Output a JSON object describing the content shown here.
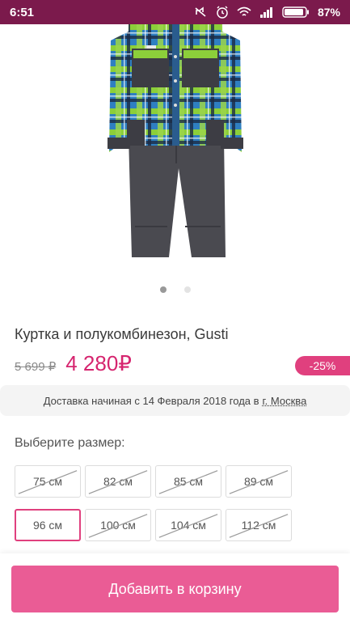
{
  "status_bar": {
    "time": "6:51",
    "battery": "87%",
    "icons": [
      "mute-icon",
      "alarm-icon",
      "wifi-icon",
      "signal-icon",
      "battery-icon"
    ]
  },
  "product": {
    "image_icon": "snowsuit-image",
    "carousel": {
      "count": 2,
      "active": 1
    },
    "title": "Куртка и полукомбинезон, Gusti",
    "old_price": "5 699 ₽",
    "price": "4 280₽",
    "discount": "-25%"
  },
  "delivery": {
    "text": "Доставка начиная с 14 Февраля 2018 года в",
    "city": "г. Москва"
  },
  "sizes": {
    "label": "Выберите размер:",
    "options": [
      {
        "label": "75 см",
        "available": false,
        "selected": false
      },
      {
        "label": "82 см",
        "available": false,
        "selected": false
      },
      {
        "label": "85 см",
        "available": false,
        "selected": false
      },
      {
        "label": "89 см",
        "available": false,
        "selected": false
      },
      {
        "label": "96 см",
        "available": true,
        "selected": true
      },
      {
        "label": "100 см",
        "available": false,
        "selected": false
      },
      {
        "label": "104 см",
        "available": false,
        "selected": false
      },
      {
        "label": "112 см",
        "available": false,
        "selected": false
      }
    ]
  },
  "actions": {
    "add_to_cart": "Добавить в корзину"
  },
  "colors": {
    "status_bar": "#7b1a4c",
    "accent": "#d6256f",
    "button": "#ea5c95"
  }
}
